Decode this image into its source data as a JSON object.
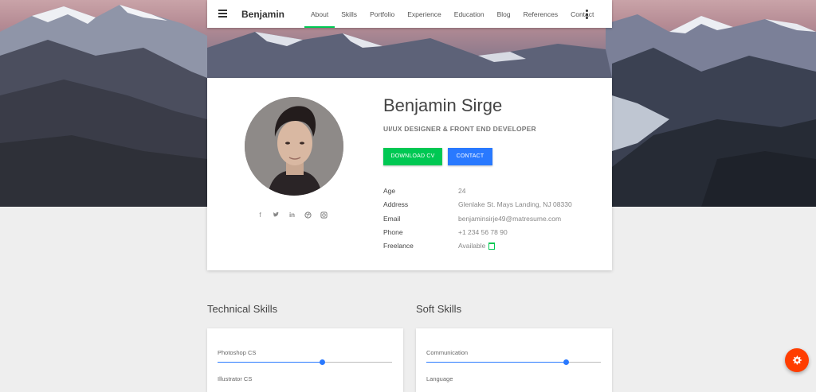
{
  "navbar": {
    "brand": "Benjamin",
    "links": [
      "About",
      "Skills",
      "Portfolio",
      "Experience",
      "Education",
      "Blog",
      "References",
      "Contact"
    ],
    "active_link": "About"
  },
  "profile": {
    "name": "Benjamin Sirge",
    "title": "UI/UX DESIGNER & FRONT END DEVELOPER",
    "download_cv_label": "DOWNLOAD CV",
    "contact_label": "CONTACT",
    "social_icons": [
      "facebook-icon",
      "twitter-icon",
      "linkedin-icon",
      "dribbble-icon",
      "instagram-icon"
    ],
    "info": [
      {
        "key": "Age",
        "value": "24"
      },
      {
        "key": "Address",
        "value": "Glenlake St. Mays Landing, NJ 08330"
      },
      {
        "key": "Email",
        "value": "benjaminsirje49@matresume.com"
      },
      {
        "key": "Phone",
        "value": "+1 234 56 78 90"
      },
      {
        "key": "Freelance",
        "value": "Available"
      }
    ]
  },
  "technical_skills": {
    "title": "Technical Skills",
    "items": [
      {
        "label": "Photoshop CS",
        "level": 0.6
      },
      {
        "label": "Illustrator CS",
        "level": null
      }
    ]
  },
  "soft_skills": {
    "title": "Soft Skills",
    "items": [
      {
        "label": "Communication",
        "level": 0.8
      },
      {
        "label": "Language",
        "level": null
      }
    ]
  },
  "colors": {
    "accent_green": "#00c853",
    "accent_blue": "#2979ff",
    "fab_orange": "#ff3d00"
  }
}
